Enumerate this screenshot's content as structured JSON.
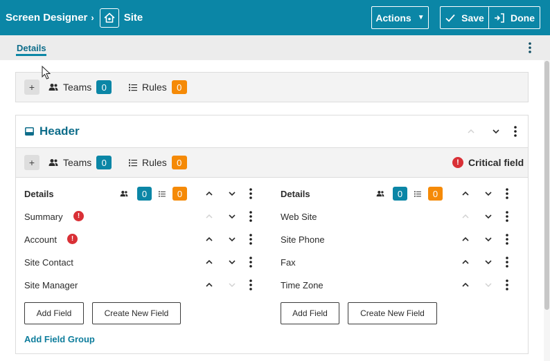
{
  "topbar": {
    "title": "Screen Designer",
    "separator": "›",
    "site_icon": "home-icon",
    "site_label": "Site",
    "actions_label": "Actions",
    "save_label": "Save",
    "done_label": "Done"
  },
  "tabs": {
    "active": "Details"
  },
  "top_panel": {
    "teams_label": "Teams",
    "teams_count": "0",
    "rules_label": "Rules",
    "rules_count": "0"
  },
  "card": {
    "title": "Header",
    "teams_label": "Teams",
    "teams_count": "0",
    "rules_label": "Rules",
    "rules_count": "0",
    "critical_label": "Critical field",
    "critical_icon": "!",
    "groups": [
      {
        "title": "Details",
        "teams_count": "0",
        "rules_count": "0",
        "fields": [
          {
            "label": "Summary",
            "required": "!"
          },
          {
            "label": "Account",
            "required": "!"
          },
          {
            "label": "Site Contact"
          },
          {
            "label": "Site Manager"
          }
        ],
        "add_field": "Add Field",
        "create_field": "Create New Field"
      },
      {
        "title": "Details",
        "teams_count": "0",
        "rules_count": "0",
        "fields": [
          {
            "label": "Web Site"
          },
          {
            "label": "Site Phone"
          },
          {
            "label": "Fax"
          },
          {
            "label": "Time Zone"
          }
        ],
        "add_field": "Add Field",
        "create_field": "Create New Field"
      }
    ],
    "add_group": "Add Field Group"
  },
  "colors": {
    "brand": "#0b86a6",
    "badge_teal": "#0b86a6",
    "badge_orange": "#f58a07",
    "critical_red": "#d93036"
  }
}
